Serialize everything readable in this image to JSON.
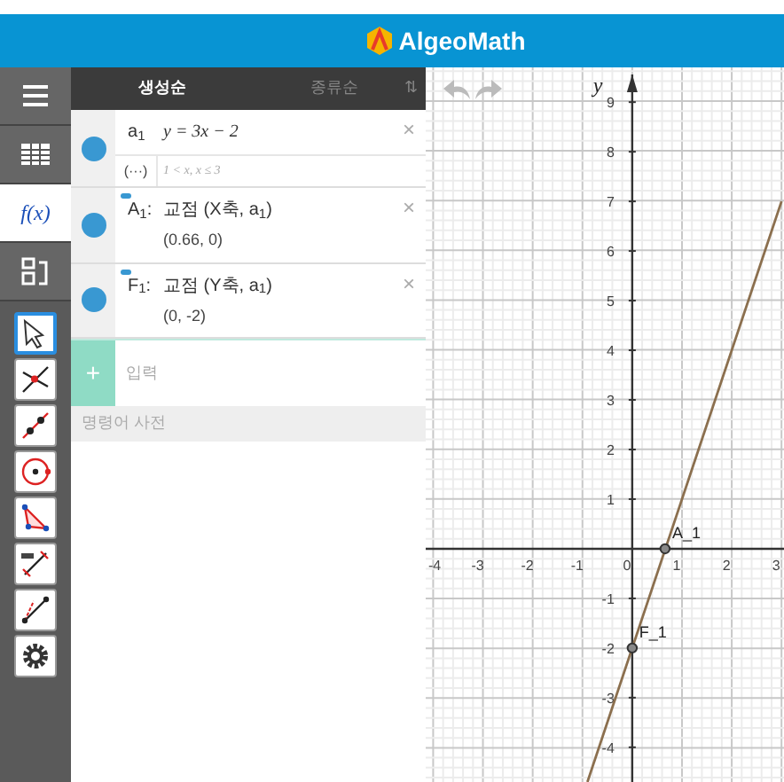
{
  "header": {
    "logo_text": "AlgeoMath"
  },
  "sidebar": {
    "items": [
      {
        "kind": "menu",
        "selected": false
      },
      {
        "kind": "table",
        "selected": false
      },
      {
        "kind": "function",
        "label": "f(x)",
        "selected": true
      },
      {
        "kind": "layout",
        "selected": false
      }
    ],
    "tools": [
      {
        "kind": "move",
        "selected": true
      },
      {
        "kind": "intersect",
        "selected": false
      },
      {
        "kind": "line",
        "selected": false
      },
      {
        "kind": "circle",
        "selected": false
      },
      {
        "kind": "triangle",
        "selected": false
      },
      {
        "kind": "measure",
        "selected": false
      },
      {
        "kind": "angle",
        "selected": false
      },
      {
        "kind": "settings",
        "selected": false
      }
    ]
  },
  "panel": {
    "sort_tabs": [
      {
        "label": "생성순",
        "selected": true
      },
      {
        "label": "종류순",
        "selected": false
      }
    ],
    "sort_icon": "⇅",
    "objects": [
      {
        "name": "a$_{1}$",
        "visible": true,
        "label_visible": false,
        "close_symbol": "×",
        "definition": "y = 3x − 2",
        "condition_button": "(···)",
        "condition": "1 < x, x ≤ 3"
      },
      {
        "name": "A$_{1}$:",
        "visible": true,
        "label_visible": true,
        "close_symbol": "×",
        "definition": "교점 (X축, a$_{1}$)",
        "value": "(0.66, 0)"
      },
      {
        "name": "F$_{1}$:",
        "visible": true,
        "label_visible": true,
        "close_symbol": "×",
        "definition": "교점 (Y축, a$_{1}$)",
        "value": "(0, -2)"
      }
    ],
    "input": {
      "placeholder": "입력",
      "add_symbol": "+"
    },
    "dictionary": "명령어 사전"
  },
  "graph": {
    "undo_disabled": true,
    "redo_disabled": true,
    "chart_data": {
      "type": "line",
      "grid": true,
      "ylabel": "y",
      "x": [
        -0.9,
        3
      ],
      "series": [
        {
          "color": "#8b6f4e",
          "values": [
            -4.7,
            7
          ]
        }
      ],
      "xlim": [
        -4.15,
        3.05
      ],
      "ylim": [
        -4.7,
        9.7
      ],
      "xticks": [
        -4,
        -3,
        -2,
        -1,
        {
          "value": 0,
          "label": "0"
        },
        1,
        2,
        3
      ],
      "yticks": [
        -4,
        -3,
        -2,
        -1,
        1,
        2,
        3,
        4,
        5,
        6,
        7,
        8,
        9
      ],
      "annotations": [
        {
          "text": "A_1",
          "x": 0.66,
          "y": 0
        },
        {
          "text": "F_1",
          "x": 0,
          "y": -2
        }
      ]
    }
  }
}
